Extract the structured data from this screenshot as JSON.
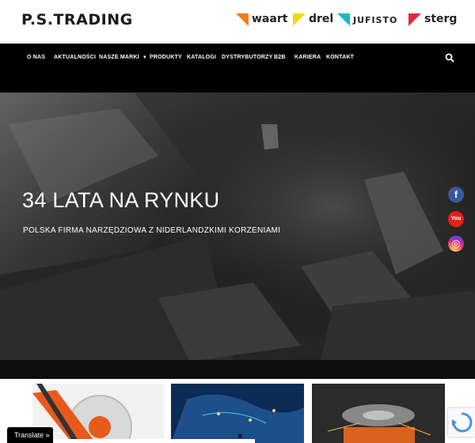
{
  "header": {
    "logo_text": "P.S.TRADING",
    "brands": [
      {
        "name": "waart",
        "color": "#f07a22",
        "icon": "waart-triangle-icon"
      },
      {
        "name": "drel",
        "color": "#f2d80a",
        "icon": "drel-triangle-icon"
      },
      {
        "name": "JUFISTO",
        "color": "#20b8c4",
        "icon": "jufisto-triangle-icon"
      },
      {
        "name": "sterg",
        "color": "#e2263a",
        "icon": "sterg-triangle-icon"
      }
    ]
  },
  "nav": {
    "items": [
      {
        "label": "O NAS"
      },
      {
        "label": "AKTUALNOŚCI"
      },
      {
        "label": "NASZE MARKI",
        "dropdown": true
      },
      {
        "label": "PRODUKTY"
      },
      {
        "label": "KATALOGI"
      },
      {
        "label": "DYSTRYBUTORZY"
      },
      {
        "label": "B2B"
      },
      {
        "label": "KARIERA"
      },
      {
        "label": "KONTAKT"
      }
    ],
    "search_icon": "search-icon"
  },
  "hero": {
    "title": "34 LATA NA RYNKU",
    "subtitle": "POLSKA FIRMA NARZĘDZIOWA Z NIDERLANDZKIMI KORZENIAMI"
  },
  "social": [
    {
      "name": "Facebook",
      "icon": "facebook-icon",
      "glyph": "f",
      "color": "#3b5998"
    },
    {
      "name": "YouTube",
      "icon": "youtube-icon",
      "glyph": "You",
      "color": "#e62117"
    },
    {
      "name": "Instagram",
      "icon": "instagram-icon",
      "glyph": "◎",
      "color": "#d6249f"
    }
  ],
  "translate": {
    "label": "Translate »",
    "close": "×"
  },
  "colors": {
    "nav_bg": "#000000",
    "header_bg": "#ffffff"
  }
}
